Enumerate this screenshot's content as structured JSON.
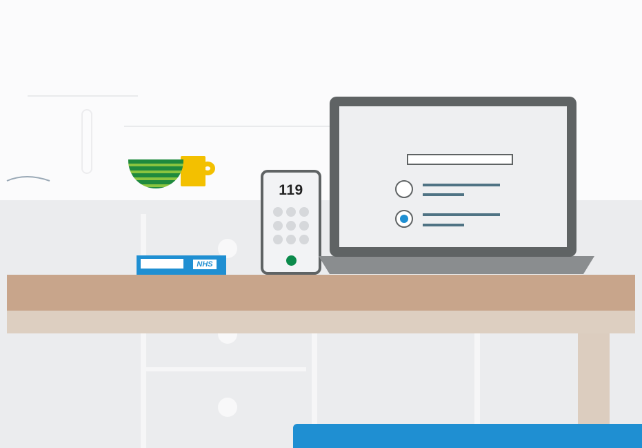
{
  "illustration": {
    "phone": {
      "number": "119"
    },
    "nhs_card": {
      "logo_text": "NHS"
    },
    "laptop": {
      "selected_option": 2
    },
    "colors": {
      "nhs_blue": "#1f8fd2",
      "device_grey": "#5f6364",
      "table": "#c8a58b",
      "call_green": "#0b8a4b",
      "mug_yellow": "#f3c000",
      "bowl_green": "#1f8a3d"
    }
  }
}
